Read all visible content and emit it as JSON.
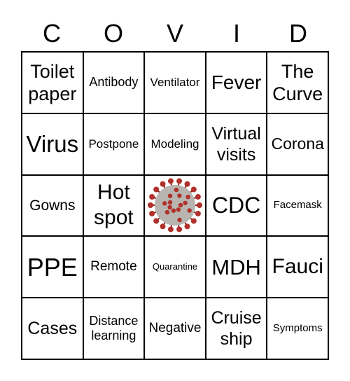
{
  "header": [
    "C",
    "O",
    "V",
    "I",
    "D"
  ],
  "cells": [
    "Toilet paper",
    "Antibody",
    "Ventilator",
    "Fever",
    "The Curve",
    "Virus",
    "Postpone",
    "Modeling",
    "Virtual visits",
    "Corona",
    "Gowns",
    "Hot spot",
    "",
    "CDC",
    "Facemask",
    "PPE",
    "Remote",
    "Quarantine",
    "MDH",
    "Fauci",
    "Cases",
    "Distance learning",
    "Negative",
    "Cruise ship",
    "Symptoms"
  ],
  "free_space_icon": "coronavirus-image",
  "colors": {
    "virus_body": "#b8b4b0",
    "virus_spikes": "#b0302a"
  }
}
